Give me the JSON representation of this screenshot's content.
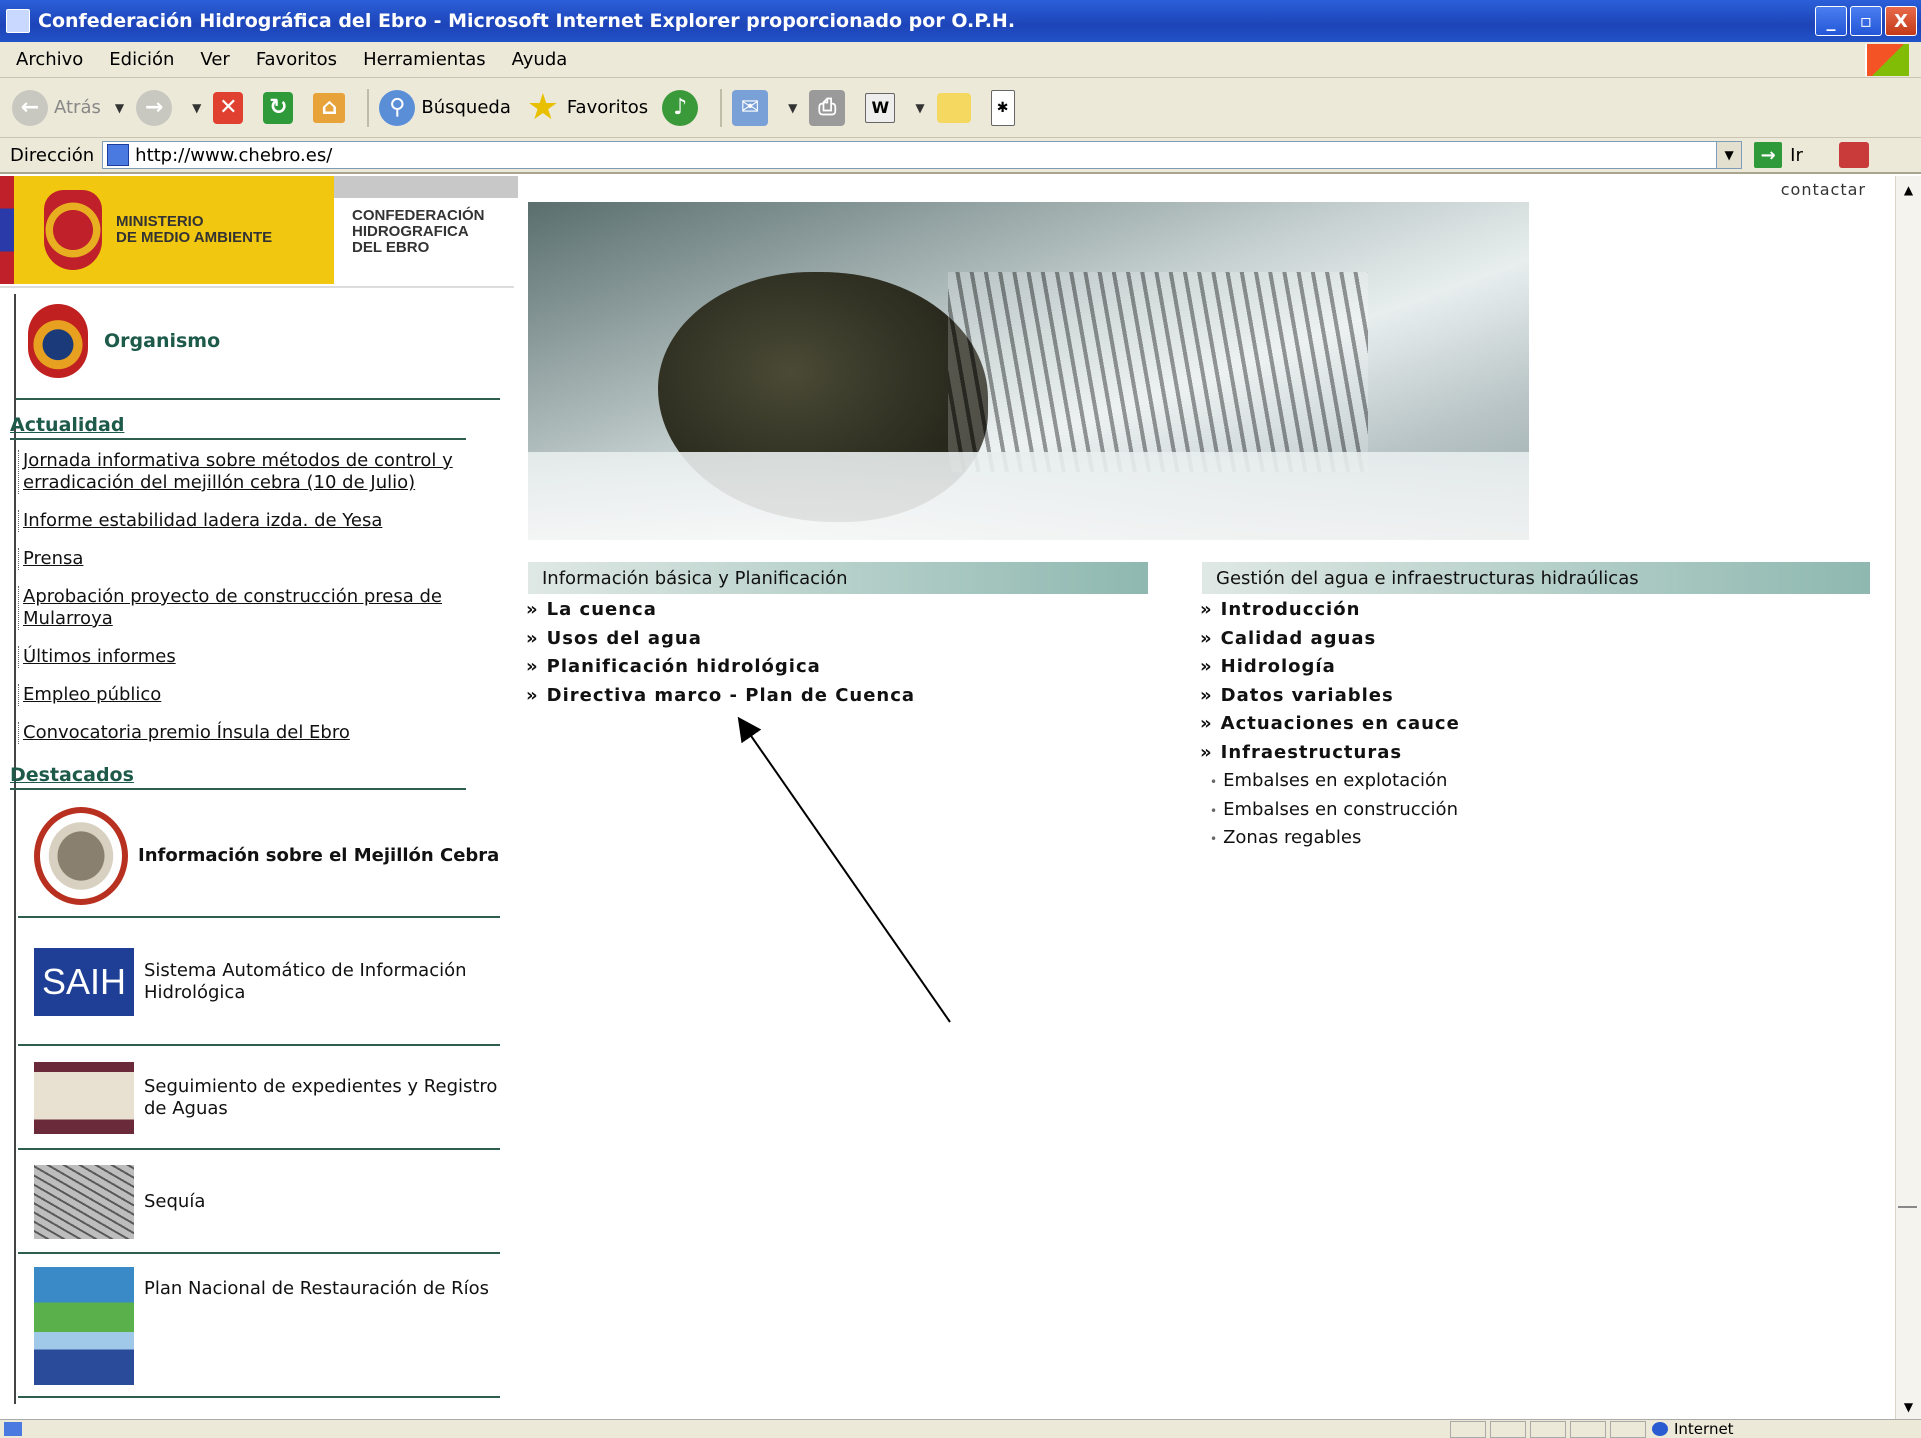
{
  "window": {
    "title": "Confederación Hidrográfica del Ebro - Microsoft Internet Explorer proporcionado por O.P.H.",
    "minimize": "_",
    "maximize": "▫",
    "close": "X"
  },
  "menu": [
    "Archivo",
    "Edición",
    "Ver",
    "Favoritos",
    "Herramientas",
    "Ayuda"
  ],
  "toolbar": {
    "back": "Atrás",
    "search": "Búsqueda",
    "favorites": "Favoritos"
  },
  "address": {
    "label": "Dirección",
    "url": "http://www.chebro.es/",
    "go": "Ir"
  },
  "header": {
    "ministry_line1": "MINISTERIO",
    "ministry_line2": "DE MEDIO AMBIENTE",
    "org_line1": "CONFEDERACIÓN",
    "org_line2": "HIDROGRAFICA",
    "org_line3": "DEL EBRO",
    "contact": "contactar"
  },
  "sidebar": {
    "organismo": "Organismo",
    "actualidad_title": "Actualidad",
    "news": [
      "Jornada informativa sobre métodos de control y erradicación del mejillón cebra (10 de Julio)",
      "Informe estabilidad ladera izda. de Yesa",
      "Prensa",
      "Aprobación proyecto de construcción presa de Mularroya",
      "Últimos informes",
      "Empleo público",
      "Convocatoria premio Ínsula del Ebro"
    ],
    "destacados_title": "Destacados",
    "featured": [
      "Información sobre el Mejillón Cebra",
      "Sistema Automático de Información Hidrológica",
      "Seguimiento de expedientes y Registro de Aguas",
      "Sequía",
      "Plan Nacional de Restauración de Ríos"
    ],
    "saih_logo": "SAIH"
  },
  "main": {
    "section1_title": "Información básica y Planificación",
    "section1_links": [
      "La cuenca",
      "Usos del agua",
      "Planificación hidrológica",
      "Directiva marco - Plan de Cuenca"
    ],
    "section2_title": "Gestión del agua e infraestructuras hidraúlicas",
    "section2_links": [
      "Introducción",
      "Calidad aguas",
      "Hidrología",
      "Datos variables",
      "Actuaciones en cauce",
      "Infraestructuras"
    ],
    "section2_sublinks": [
      "Embalses en explotación",
      "Embalses en construcción",
      "Zonas regables"
    ]
  },
  "status": {
    "zone": "Internet"
  }
}
